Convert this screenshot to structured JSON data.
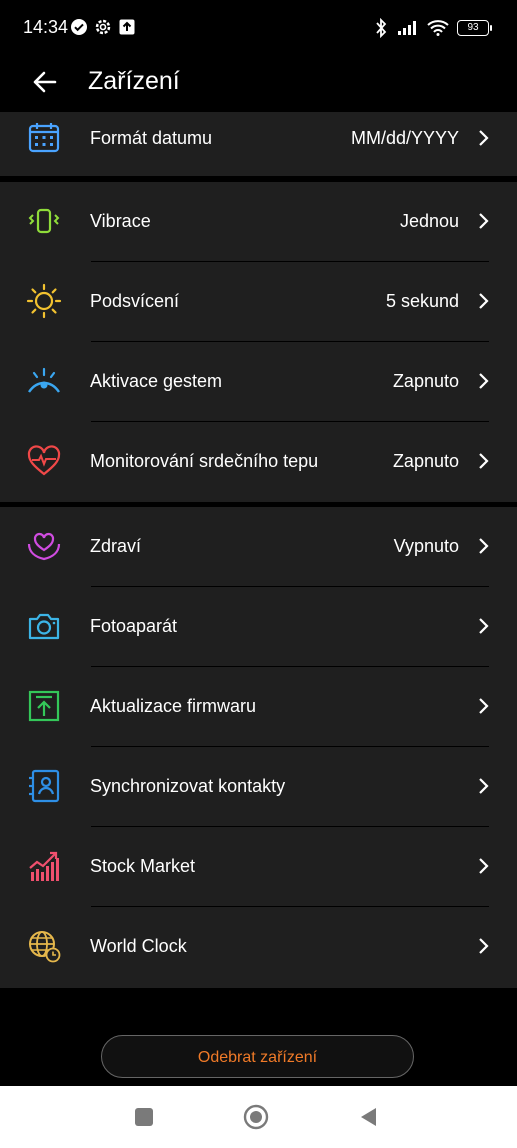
{
  "status_bar": {
    "time": "14:34",
    "battery": "93"
  },
  "header": {
    "title": "Zařízení"
  },
  "sections": [
    {
      "rows": [
        {
          "id": "date-format",
          "label": "Formát datumu",
          "value": "MM/dd/YYYY",
          "icon": "calendar-icon",
          "color": "#4aa3ff"
        }
      ]
    },
    {
      "rows": [
        {
          "id": "vibration",
          "label": "Vibrace",
          "value": "Jednou",
          "icon": "vibrate-icon",
          "color": "#8fdc3a"
        },
        {
          "id": "backlight",
          "label": "Podsvícení",
          "value": "5 sekund",
          "icon": "sun-icon",
          "color": "#f2c230"
        },
        {
          "id": "gesture",
          "label": "Aktivace gestem",
          "value": "Zapnuto",
          "icon": "gesture-icon",
          "color": "#3aa6f0"
        },
        {
          "id": "heart-rate",
          "label": "Monitorování srdečního tepu",
          "value": "Zapnuto",
          "icon": "heart-rate-icon",
          "color": "#f04848"
        }
      ]
    },
    {
      "rows": [
        {
          "id": "health",
          "label": "Zdraví",
          "value": "Vypnuto",
          "icon": "health-hands-icon",
          "color": "#d04ce0"
        },
        {
          "id": "camera",
          "label": "Fotoaparát",
          "value": "",
          "icon": "camera-icon",
          "color": "#3cb4e6"
        },
        {
          "id": "firmware",
          "label": "Aktualizace firmwaru",
          "value": "",
          "icon": "firmware-update-icon",
          "color": "#34c759"
        },
        {
          "id": "contacts",
          "label": "Synchronizovat kontakty",
          "value": "",
          "icon": "contacts-icon",
          "color": "#2e8fe6"
        },
        {
          "id": "stock",
          "label": "Stock Market",
          "value": "",
          "icon": "stock-chart-icon",
          "color": "#f0506e"
        },
        {
          "id": "world-clock",
          "label": "World Clock",
          "value": "",
          "icon": "world-clock-icon",
          "color": "#e6b84c"
        }
      ]
    }
  ],
  "remove_button": {
    "label": "Odebrat zařízení",
    "color": "#f07a28"
  }
}
